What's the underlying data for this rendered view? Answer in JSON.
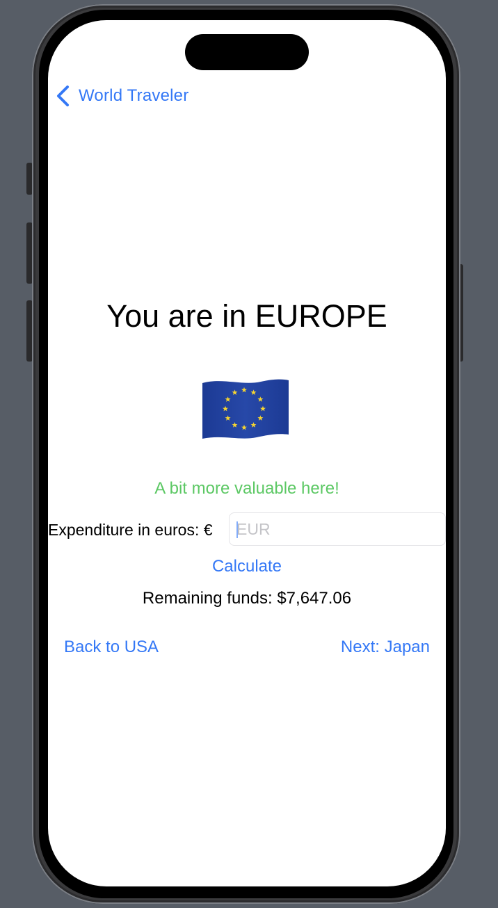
{
  "nav": {
    "back_label": "World Traveler"
  },
  "main": {
    "title": "You are in EUROPE",
    "flag_icon": "eu-flag-icon",
    "tagline": "A bit more valuable here!",
    "expenditure_label": "Expenditure in euros: €",
    "expenditure_value": "",
    "expenditure_placeholder": "EUR",
    "calculate_label": "Calculate",
    "remaining_funds": "Remaining funds: $7,647.06"
  },
  "footer": {
    "back_label": "Back to USA",
    "next_label": "Next: Japan"
  },
  "colors": {
    "accent": "#3478f6",
    "positive": "#5cc864",
    "flag_blue": "#1f3f9a",
    "flag_star": "#f5d431",
    "background": "#575d66"
  }
}
